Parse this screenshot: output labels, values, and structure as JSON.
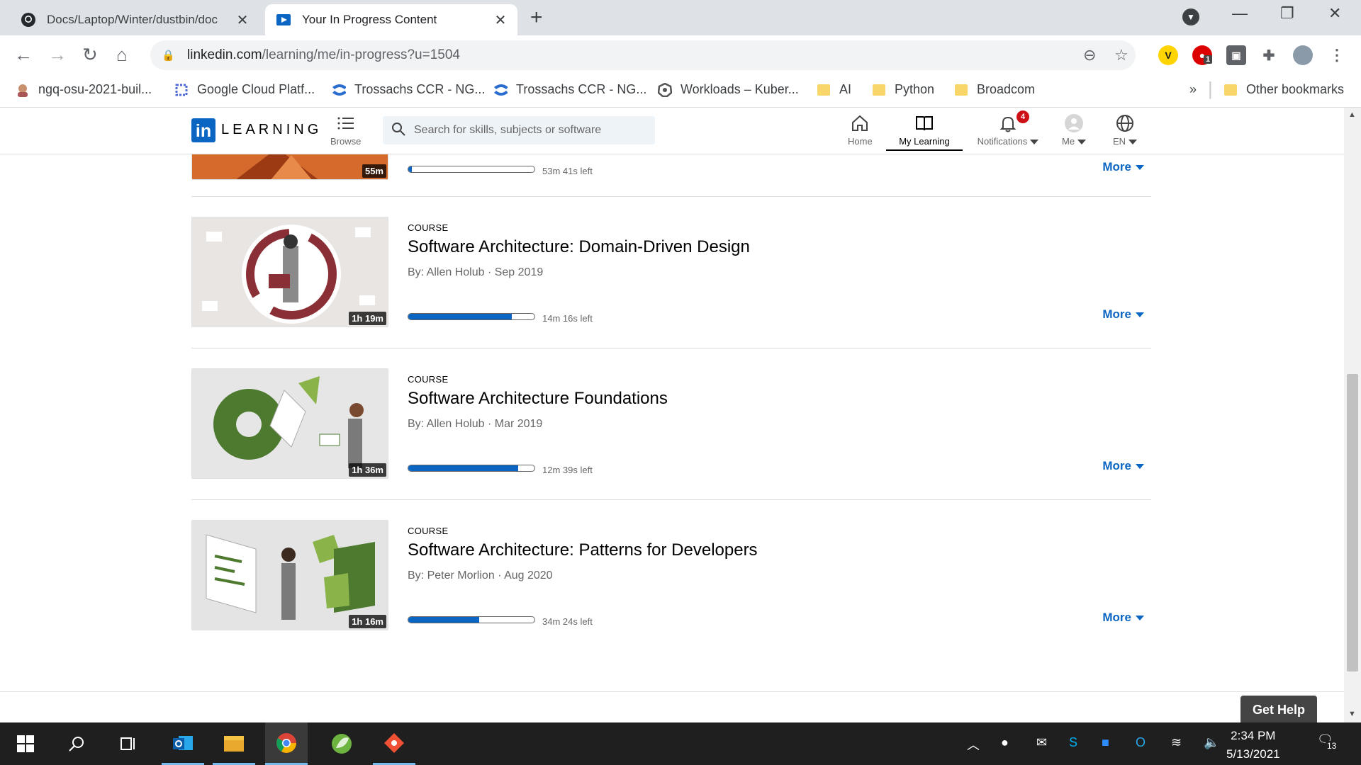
{
  "browser": {
    "tabs": [
      {
        "title": "Docs/Laptop/Winter/dustbin/doc",
        "icon": "github-icon",
        "active": false
      },
      {
        "title": "Your In Progress Content",
        "icon": "linkedin-learning-icon",
        "active": true
      }
    ],
    "url_host": "linkedin.com",
    "url_path": "/learning/me/in-progress?u=1504",
    "bookmarks": [
      {
        "label": "ngq-osu-2021-buil...",
        "icon": "avatar-icon"
      },
      {
        "label": "Google Cloud Platf...",
        "icon": "gcp-icon"
      },
      {
        "label": "Trossachs CCR - NG...",
        "icon": "confluence-icon"
      },
      {
        "label": "Trossachs CCR - NG...",
        "icon": "confluence-icon"
      },
      {
        "label": "Workloads – Kuber...",
        "icon": "kubernetes-icon"
      },
      {
        "label": "AI",
        "icon": "folder-icon"
      },
      {
        "label": "Python",
        "icon": "folder-icon"
      },
      {
        "label": "Broadcom",
        "icon": "folder-icon"
      }
    ],
    "bookmarks_overflow": "»",
    "other_bookmarks": "Other bookmarks",
    "ext_badge": "1"
  },
  "header": {
    "logo_in": "in",
    "logo_text": "LEARNING",
    "browse": "Browse",
    "search_placeholder": "Search for skills, subjects or software",
    "nav": {
      "home": "Home",
      "my_learning": "My Learning",
      "notifications": "Notifications",
      "notifications_count": "4",
      "me": "Me",
      "lang": "EN"
    }
  },
  "courses": [
    {
      "type": "",
      "title": "",
      "by": "",
      "duration": "55m",
      "progress": 0.03,
      "left": "53m 41s left",
      "more": "More"
    },
    {
      "type": "COURSE",
      "title": "Software Architecture: Domain-Driven Design",
      "by": "By: Allen Holub",
      "date": "Sep 2019",
      "duration": "1h 19m",
      "progress": 0.82,
      "left": "14m 16s left",
      "more": "More"
    },
    {
      "type": "COURSE",
      "title": "Software Architecture Foundations",
      "by": "By: Allen Holub",
      "date": "Mar 2019",
      "duration": "1h 36m",
      "progress": 0.87,
      "left": "12m 39s left",
      "more": "More"
    },
    {
      "type": "COURSE",
      "title": "Software Architecture: Patterns for Developers",
      "by": "By: Peter Morlion",
      "date": "Aug 2020",
      "duration": "1h 16m",
      "progress": 0.56,
      "left": "34m 24s left",
      "more": "More"
    }
  ],
  "get_help": "Get Help",
  "taskbar": {
    "time": "2:34 PM",
    "date": "5/13/2021",
    "notification_count": "13"
  },
  "colors": {
    "accent": "#0a66c2",
    "badge": "#cc1016"
  }
}
